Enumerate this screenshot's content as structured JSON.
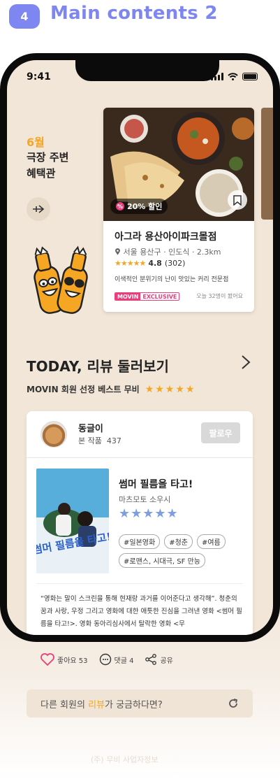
{
  "header": {
    "step": "4",
    "title": "Main contents 2"
  },
  "status_bar": {
    "time": "9:41"
  },
  "promo": {
    "month": "6월",
    "title_line1": "극장 주변",
    "title_line2": "혜택관",
    "button_icon": "arrow-icon"
  },
  "restaurant": {
    "discount": "20% 할인",
    "name": "아그라 용산아이파크몰점",
    "location": "서울 용산구 · 인도식 · 2.3km",
    "rating": "4.8",
    "reviews": "(302)",
    "description": "이색적인 분위기의 난이 맛있는 커리 전문점",
    "tag_brand": "MOVIN",
    "tag_label": "EXCLUSIVE",
    "views": "오늘 32명이 봤어요"
  },
  "today": {
    "title": "TODAY, 리뷰 둘러보기",
    "subtitle": "MOVIN 회원 선정 베스트 무비",
    "stars": "★★★★★"
  },
  "review": {
    "user": "동글이",
    "count_label": "본 작품",
    "count": "437",
    "follow": "팔로우",
    "movie_title": "썸머 필름을 타고!",
    "movie_author": "마츠모토 소우시",
    "movie_stars": "★★★★★",
    "tags": [
      "#일본영화",
      "#청춘",
      "#여름",
      "#로맨스, 시대극, SF 만능"
    ],
    "poster_title": "썸머 필름을 타고!",
    "quote": "“영화는 말이 스크린을 통해 현재랑 과거를 이어준다고 생각해”. 청춘의 꿈과 사랑, 우정 그리고 영화에 대한 애틋한 진심을 그려낸 영화 <썸머 필름을 타고!>. 영화 동아리심사에서 탈락한 영화 <무"
  },
  "actions": {
    "like": "좋아요 53",
    "comment": "댓글 4",
    "share": "공유"
  },
  "more": {
    "prefix": "다른 회원의 ",
    "highlight": "리뷰",
    "suffix": "가 궁금하다면?"
  },
  "faded_text": "(주) 무비 사업자정보"
}
